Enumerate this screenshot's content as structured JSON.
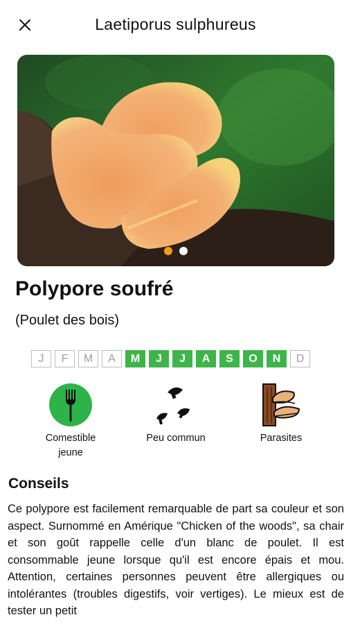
{
  "header": {
    "title": "Laetiporus sulphureus"
  },
  "icons": {
    "close": "close-icon"
  },
  "carousel": {
    "total": 2,
    "active_index": 0,
    "accent": "#f39c12"
  },
  "species": {
    "name": "Polypore soufré",
    "alt_name": "(Poulet des bois)"
  },
  "months": [
    {
      "label": "J",
      "active": false
    },
    {
      "label": "F",
      "active": false
    },
    {
      "label": "M",
      "active": false
    },
    {
      "label": "A",
      "active": false
    },
    {
      "label": "M",
      "active": true
    },
    {
      "label": "J",
      "active": true
    },
    {
      "label": "J",
      "active": true
    },
    {
      "label": "A",
      "active": true
    },
    {
      "label": "S",
      "active": true
    },
    {
      "label": "O",
      "active": true
    },
    {
      "label": "N",
      "active": true
    },
    {
      "label": "D",
      "active": false
    }
  ],
  "season_color": "#3eb54a",
  "features": [
    {
      "label": "Comestible jeune",
      "icon": "fork-icon"
    },
    {
      "label": "Peu commun",
      "icon": "mushrooms-scatter-icon"
    },
    {
      "label": "Parasites",
      "icon": "tree-fungus-icon"
    }
  ],
  "advice": {
    "title": "Conseils",
    "text": "Ce polypore est facilement remarquable de part sa couleur et son aspect. Surnommé en Amérique \"Chicken of the woods\", sa chair et son goût rappelle celle d'un blanc de poulet. Il est consommable jeune lorsque qu'il est encore épais et mou. Attention, certaines personnes peuvent être allergiques ou intolérantes (troubles digestifs, voir vertiges). Le mieux est de tester un petit"
  }
}
